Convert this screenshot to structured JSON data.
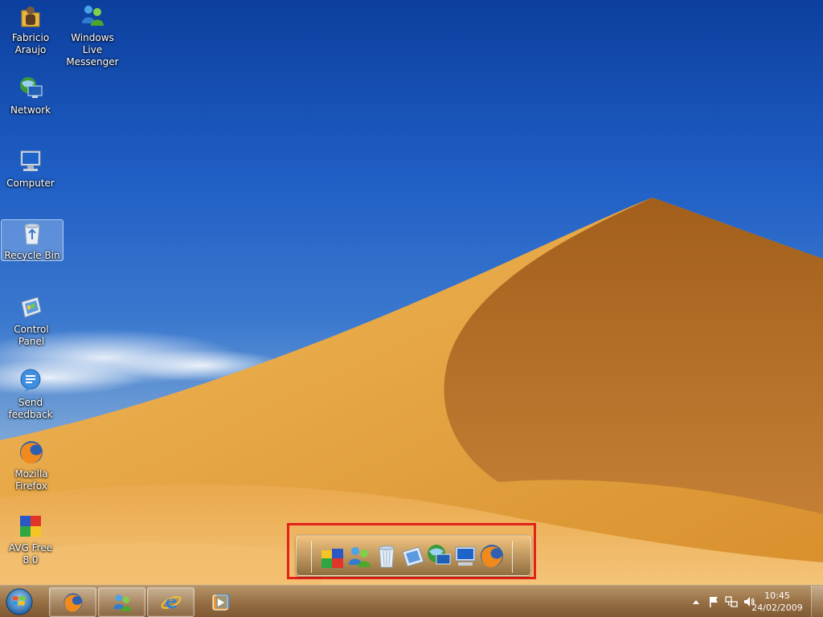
{
  "desktop": {
    "icons": [
      {
        "label": "Fabricio Araujo",
        "icon": "user-folder-icon"
      },
      {
        "label": "Windows Live Messenger",
        "icon": "messenger-icon"
      },
      {
        "label": "Network",
        "icon": "network-icon"
      },
      {
        "label": "Computer",
        "icon": "computer-icon"
      },
      {
        "label": "Recycle Bin",
        "icon": "recycle-bin-icon",
        "selected": true
      },
      {
        "label": "Control Panel",
        "icon": "control-panel-icon"
      },
      {
        "label": "Send feedback",
        "icon": "feedback-icon"
      },
      {
        "label": "Mozilla Firefox",
        "icon": "firefox-icon"
      },
      {
        "label": "AVG Free 8.0",
        "icon": "avg-icon"
      }
    ]
  },
  "dock": {
    "highlight_color": "#e3201c",
    "items": [
      "avg-icon",
      "messenger-icon",
      "recycle-bin-icon",
      "control-panel-icon",
      "network-icon",
      "computer-icon",
      "firefox-icon"
    ]
  },
  "taskbar": {
    "pinned": [
      "firefox-icon",
      "messenger-icon",
      "internet-explorer-icon",
      "media-player-icon"
    ],
    "tray": [
      "show-hidden-icons-icon",
      "action-center-flag-icon",
      "network-status-icon",
      "volume-icon"
    ],
    "clock": {
      "time": "10:45",
      "date": "24/02/2009"
    }
  }
}
